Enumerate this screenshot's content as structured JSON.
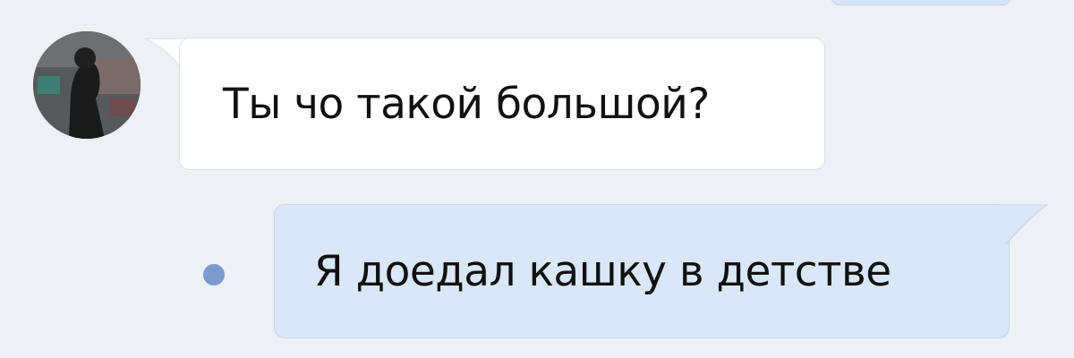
{
  "messages": [
    {
      "direction": "incoming",
      "text": "Ты чо такой большой?"
    },
    {
      "direction": "outgoing",
      "text": "Я доедал кашку в детстве",
      "status": "unread"
    }
  ],
  "colors": {
    "background": "#edf0f5",
    "incoming_bubble": "#ffffff",
    "outgoing_bubble": "#dae7f8",
    "unread_dot": "#7b9ccc"
  }
}
